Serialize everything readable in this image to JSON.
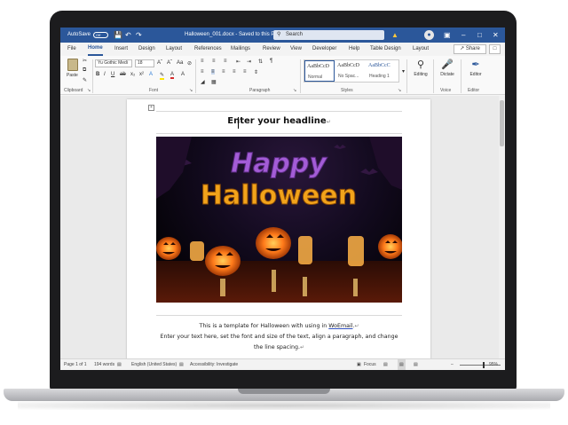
{
  "titlebar": {
    "autosave_label": "AutoSave",
    "autosave_state": "Off",
    "document_title": "Halloween_001.docx - Saved to this PC",
    "search_placeholder": "Search",
    "icons": [
      "save-icon",
      "undo-icon",
      "redo-icon",
      "search-icon",
      "warning-icon",
      "avatar",
      "ribbon-display-icon",
      "minimize-icon",
      "maximize-icon",
      "close-icon"
    ]
  },
  "menu": {
    "tabs": [
      {
        "label": "File"
      },
      {
        "label": "Home"
      },
      {
        "label": "Insert"
      },
      {
        "label": "Design"
      },
      {
        "label": "Layout"
      },
      {
        "label": "References"
      },
      {
        "label": "Mailings"
      },
      {
        "label": "Review"
      },
      {
        "label": "View"
      },
      {
        "label": "Developer"
      },
      {
        "label": "Help"
      },
      {
        "label": "Table Design"
      },
      {
        "label": "Layout"
      }
    ],
    "active_tab": "Home",
    "share_label": "Share"
  },
  "ribbon": {
    "clipboard": {
      "paste_label": "Paste",
      "group_label": "Clipboard"
    },
    "font": {
      "font_name": "Yu Gothic Medi",
      "font_size": "18",
      "group_label": "Font"
    },
    "paragraph": {
      "group_label": "Paragraph"
    },
    "styles": {
      "group_label": "Styles",
      "items": [
        {
          "sample": "AaBbCcD",
          "name": "Normal"
        },
        {
          "sample": "AaBbCcD",
          "name": "No Spac..."
        },
        {
          "sample": "AaBbCcC",
          "name": "Heading 1"
        }
      ]
    },
    "editing": {
      "label": "Editing"
    },
    "voice": {
      "dictate_label": "Dictate",
      "group_label": "Voice"
    },
    "editor": {
      "label": "Editor",
      "group_label": "Editor"
    }
  },
  "document": {
    "headline": "Enter your headline",
    "image_text": {
      "line1": "Happy",
      "line2": "Halloween"
    },
    "body_line1_pre": "This is a template for Halloween with using in ",
    "body_line1_link": "WoEmail",
    "body_line1_post": ".",
    "body_line2": "Enter your text here, set the font and size of the text, align a paragraph, and change",
    "body_line3": "the line spacing."
  },
  "statusbar": {
    "page": "Page 1 of 1",
    "words": "194 words",
    "language": "English (United States)",
    "accessibility": "Accessibility: Investigate",
    "focus": "Focus",
    "zoom": "95%"
  },
  "colors": {
    "word_blue": "#2b579a",
    "pumpkin": "#ff7a1a",
    "happy_purple": "#a35cd6",
    "halloween_orange": "#f2a31b"
  }
}
